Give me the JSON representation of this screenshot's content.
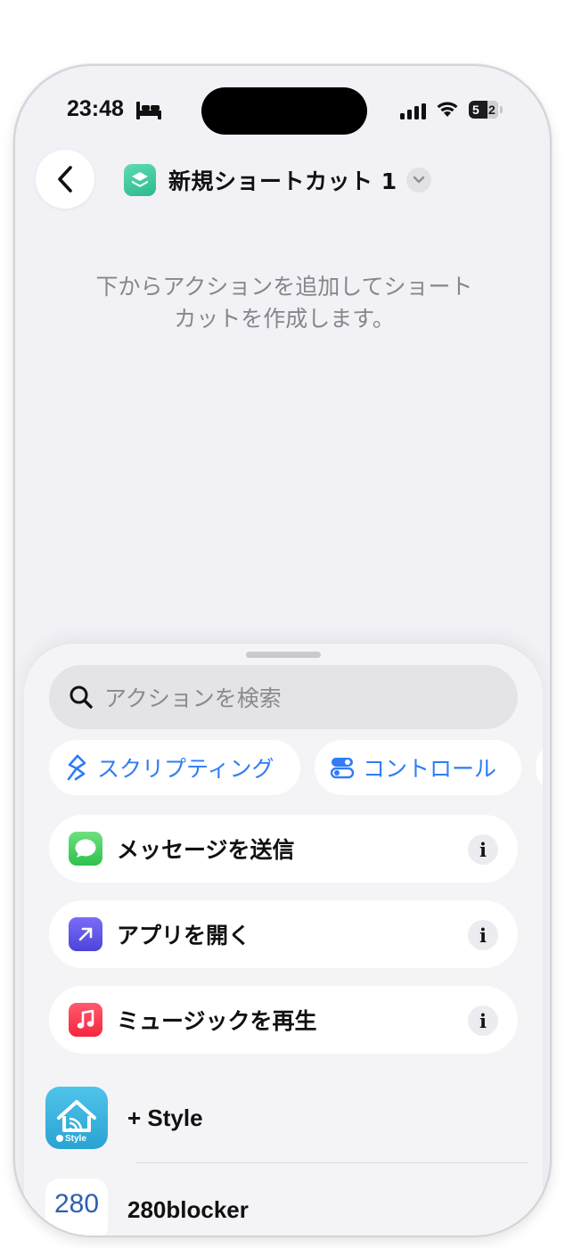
{
  "status_bar": {
    "time": "23:48",
    "battery_level": "52",
    "battery_first_digit": "5",
    "battery_second_digit": "2"
  },
  "header": {
    "title": "新規ショートカット 1"
  },
  "editor": {
    "empty_hint_line1": "下からアクションを追加してショート",
    "empty_hint_line2": "カットを作成します。"
  },
  "action_sheet": {
    "search": {
      "placeholder": "アクションを検索"
    },
    "categories": [
      {
        "label": "スクリプティング",
        "icon": "scripting-icon"
      },
      {
        "label": "コントロール",
        "icon": "controls-icon"
      }
    ],
    "suggestions": [
      {
        "label": "メッセージを送信",
        "icon": "messages-icon",
        "color": "#34c759"
      },
      {
        "label": "アプリを開く",
        "icon": "open-app-icon",
        "color": "#5e5ce6"
      },
      {
        "label": "ミュージックを再生",
        "icon": "music-icon",
        "color": "#fc3c44"
      }
    ],
    "info_glyph": "i",
    "apps": [
      {
        "label": "+ Style",
        "icon": "plus-style-app-icon",
        "icon_text": "Style"
      },
      {
        "label": "280blocker",
        "icon": "280blocker-app-icon",
        "icon_text": "280"
      }
    ]
  },
  "colors": {
    "accent": "#2f7cf6",
    "background": "#f2f1f6",
    "shortcut_icon": "#2cb98f"
  }
}
